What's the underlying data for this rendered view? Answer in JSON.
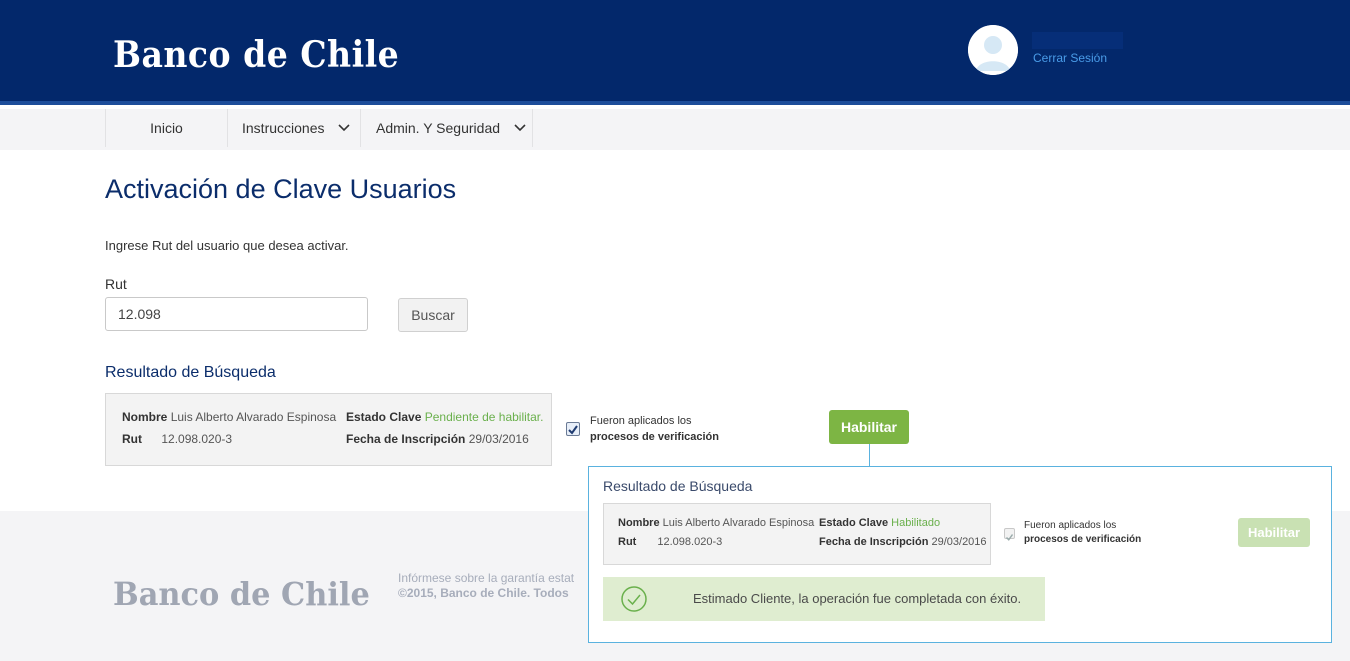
{
  "header": {
    "logo": "Banco de Chile",
    "logout_label": "Cerrar Sesión"
  },
  "nav": {
    "items": [
      {
        "label": "Inicio"
      },
      {
        "label": "Instrucciones"
      },
      {
        "label": "Admin. Y Seguridad"
      }
    ]
  },
  "main": {
    "title": "Activación de Clave Usuarios",
    "instructions": "Ingrese Rut del usuario que desea activar.",
    "rut_label": "Rut",
    "rut_value": "12.098",
    "search_button": "Buscar",
    "result_title": "Resultado de Búsqueda",
    "result": {
      "nombre_label": "Nombre",
      "nombre_value": "Luis Alberto Alvarado Espinosa",
      "rut_label": "Rut",
      "rut_value": "12.098.020-3",
      "estado_label": "Estado Clave",
      "estado_value": "Pendiente de habilitar.",
      "fecha_label": "Fecha de Inscripción",
      "fecha_value": "29/03/2016"
    },
    "verification_line1": "Fueron aplicados los",
    "verification_line2": "procesos de verificación",
    "verification_checked": true,
    "habilitar_button": "Habilitar"
  },
  "popup": {
    "title": "Resultado de Búsqueda",
    "result": {
      "nombre_label": "Nombre",
      "nombre_value": "Luis Alberto Alvarado Espinosa",
      "rut_label": "Rut",
      "rut_value": "12.098.020-3",
      "estado_label": "Estado Clave",
      "estado_value": "Habilitado",
      "fecha_label": "Fecha de Inscripción",
      "fecha_value": "29/03/2016"
    },
    "verification_line1": "Fueron aplicados los",
    "verification_line2": "procesos de verificación",
    "habilitar_button": "Habilitar",
    "success_message": "Estimado Cliente, la operación fue completada con éxito."
  },
  "footer": {
    "logo": "Banco de Chile",
    "line1": "Infórmese sobre la garantía estat",
    "line2": "©2015, Banco de Chile. Todos"
  },
  "colors": {
    "brand_navy": "#03286b",
    "accent_green": "#7db544",
    "link_blue": "#4a9ce8"
  }
}
